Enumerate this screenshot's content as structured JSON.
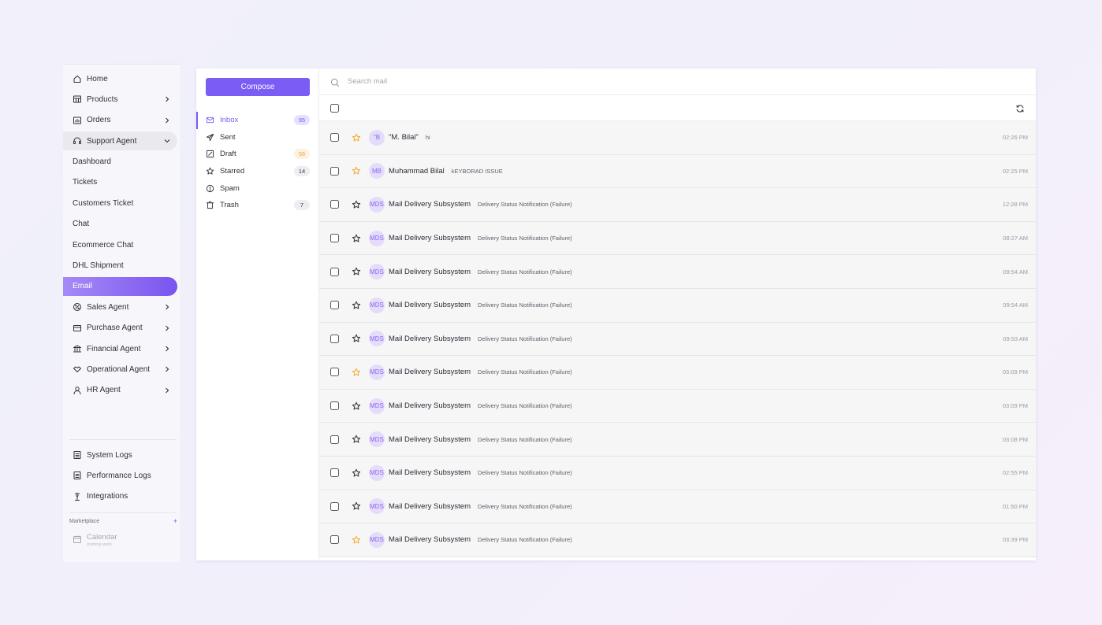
{
  "sidebar": {
    "items": [
      {
        "label": "Home",
        "icon": "home-icon",
        "chevron": false
      },
      {
        "label": "Products",
        "icon": "products-icon",
        "chevron": true
      },
      {
        "label": "Orders",
        "icon": "orders-icon",
        "chevron": true
      },
      {
        "label": "Support Agent",
        "icon": "headset-icon",
        "chevron": true,
        "expanded": true
      },
      {
        "label": "Dashboard",
        "sub": true
      },
      {
        "label": "Tickets",
        "sub": true
      },
      {
        "label": "Customers Ticket",
        "sub": true
      },
      {
        "label": "Chat",
        "sub": true
      },
      {
        "label": "Ecommerce Chat",
        "sub": true
      },
      {
        "label": "DHL Shipment",
        "sub": true
      },
      {
        "label": "Email",
        "sub": true,
        "active": true
      },
      {
        "label": "Sales Agent",
        "icon": "sales-icon",
        "chevron": true
      },
      {
        "label": "Purchase Agent",
        "icon": "purchase-icon",
        "chevron": true
      },
      {
        "label": "Financial Agent",
        "icon": "bank-icon",
        "chevron": true
      },
      {
        "label": "Operational Agent",
        "icon": "handshake-icon",
        "chevron": true
      },
      {
        "label": "HR Agent",
        "icon": "user-icon",
        "chevron": true
      }
    ],
    "bottom_items": [
      {
        "label": "System Logs",
        "icon": "log-icon"
      },
      {
        "label": "Performance Logs",
        "icon": "log-icon"
      },
      {
        "label": "Integrations",
        "icon": "integrations-icon"
      }
    ],
    "marketplace": {
      "label": "Marketplace",
      "add": "+"
    },
    "calendar": {
      "label": "Calendar",
      "note": "(coming soon)"
    }
  },
  "mail": {
    "compose_label": "Compose",
    "folders": [
      {
        "label": "Inbox",
        "icon": "mail-icon",
        "count": "95",
        "active": true
      },
      {
        "label": "Sent",
        "icon": "send-icon",
        "count": ""
      },
      {
        "label": "Draft",
        "icon": "draft-icon",
        "count": "56",
        "draft": true
      },
      {
        "label": "Starred",
        "icon": "star-icon",
        "count": "14"
      },
      {
        "label": "Spam",
        "icon": "spam-icon",
        "count": ""
      },
      {
        "label": "Trash",
        "icon": "trash-icon",
        "count": "7"
      }
    ],
    "search_placeholder": "Search mail",
    "rows": [
      {
        "avatar": "\"B",
        "sender": "\"M. Bilal\"",
        "subject": "hi",
        "time": "02:26 PM",
        "starred": true
      },
      {
        "avatar": "MB",
        "sender": "Muhammad Bilal",
        "subject": "kEYBORAD ISSUE",
        "time": "02:25 PM",
        "starred": true
      },
      {
        "avatar": "MDS",
        "sender": "Mail Delivery Subsystem",
        "subject": "Delivery Status Notification (Failure)",
        "time": "12:28 PM",
        "starred": false
      },
      {
        "avatar": "MDS",
        "sender": "Mail Delivery Subsystem",
        "subject": "Delivery Status Notification (Failure)",
        "time": "08:27 AM",
        "starred": false
      },
      {
        "avatar": "MDS",
        "sender": "Mail Delivery Subsystem",
        "subject": "Delivery Status Notification (Failure)",
        "time": "09:54 AM",
        "starred": false
      },
      {
        "avatar": "MDS",
        "sender": "Mail Delivery Subsystem",
        "subject": "Delivery Status Notification (Failure)",
        "time": "09:54 AM",
        "starred": false
      },
      {
        "avatar": "MDS",
        "sender": "Mail Delivery Subsystem",
        "subject": "Delivery Status Notification (Failure)",
        "time": "09:53 AM",
        "starred": false
      },
      {
        "avatar": "MDS",
        "sender": "Mail Delivery Subsystem",
        "subject": "Delivery Status Notification (Failure)",
        "time": "03:09 PM",
        "starred": true
      },
      {
        "avatar": "MDS",
        "sender": "Mail Delivery Subsystem",
        "subject": "Delivery Status Notification (Failure)",
        "time": "03:09 PM",
        "starred": false
      },
      {
        "avatar": "MDS",
        "sender": "Mail Delivery Subsystem",
        "subject": "Delivery Status Notification (Failure)",
        "time": "03:08 PM",
        "starred": false
      },
      {
        "avatar": "MDS",
        "sender": "Mail Delivery Subsystem",
        "subject": "Delivery Status Notification (Failure)",
        "time": "02:55 PM",
        "starred": false
      },
      {
        "avatar": "MDS",
        "sender": "Mail Delivery Subsystem",
        "subject": "Delivery Status Notification (Failure)",
        "time": "01:50 PM",
        "starred": false
      },
      {
        "avatar": "MDS",
        "sender": "Mail Delivery Subsystem",
        "subject": "Delivery Status Notification (Failure)",
        "time": "03:39 PM",
        "starred": true
      }
    ]
  },
  "colors": {
    "accent": "#7b5cf4",
    "star_filled": "#f0b03a",
    "star_empty": "#3b3b46"
  }
}
